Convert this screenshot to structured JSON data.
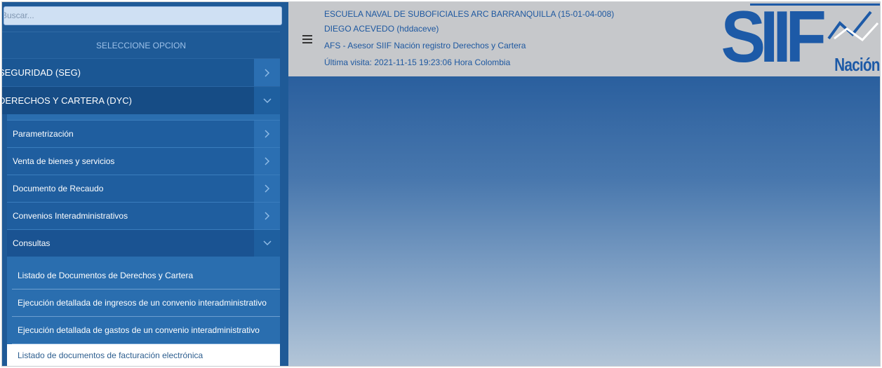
{
  "search": {
    "placeholder": "Buscar..."
  },
  "sidebar": {
    "header": "SELECCIONE OPCION",
    "sections": [
      {
        "label": "SEGURIDAD (SEG)",
        "state": "collapsed"
      },
      {
        "label": "DERECHOS Y CARTERA (DYC)",
        "state": "expanded"
      }
    ],
    "subsections": [
      {
        "label": "Parametrización",
        "state": "collapsed"
      },
      {
        "label": "Venta de bienes y servicios",
        "state": "collapsed"
      },
      {
        "label": "Documento de Recaudo",
        "state": "collapsed"
      },
      {
        "label": "Convenios Interadministrativos",
        "state": "collapsed"
      },
      {
        "label": "Consultas",
        "state": "expanded"
      }
    ],
    "leaves": [
      {
        "label": "Listado de Documentos de Derechos y Cartera"
      },
      {
        "label": "Ejecución detallada de ingresos de un convenio interadministrativo"
      },
      {
        "label": "Ejecución detallada de gastos de un convenio interadministrativo"
      },
      {
        "label": "Listado de documentos de facturación electrónica",
        "active": true
      }
    ]
  },
  "header": {
    "entity": "ESCUELA NAVAL DE SUBOFICIALES ARC BARRANQUILLA (15-01-04-008)",
    "user": "DIEGO ACEVEDO (hddaceve)",
    "role": "AFS - Asesor SIIF Nación registro Derechos y Cartera",
    "last_visit": "Última visita: 2021-11-15 19:23:06 Hora Colombia"
  },
  "logo": {
    "main": "SIIF",
    "sub": "Nación"
  },
  "icons": {
    "menu": "hamburger-icon",
    "collapsed": "chevron-right-icon",
    "expanded": "chevron-down-icon"
  },
  "colors": {
    "sidebar": "#1f5a97",
    "header": "#c6c8cb",
    "header_text": "#1e58a0",
    "logo": "#1d5aa7"
  }
}
